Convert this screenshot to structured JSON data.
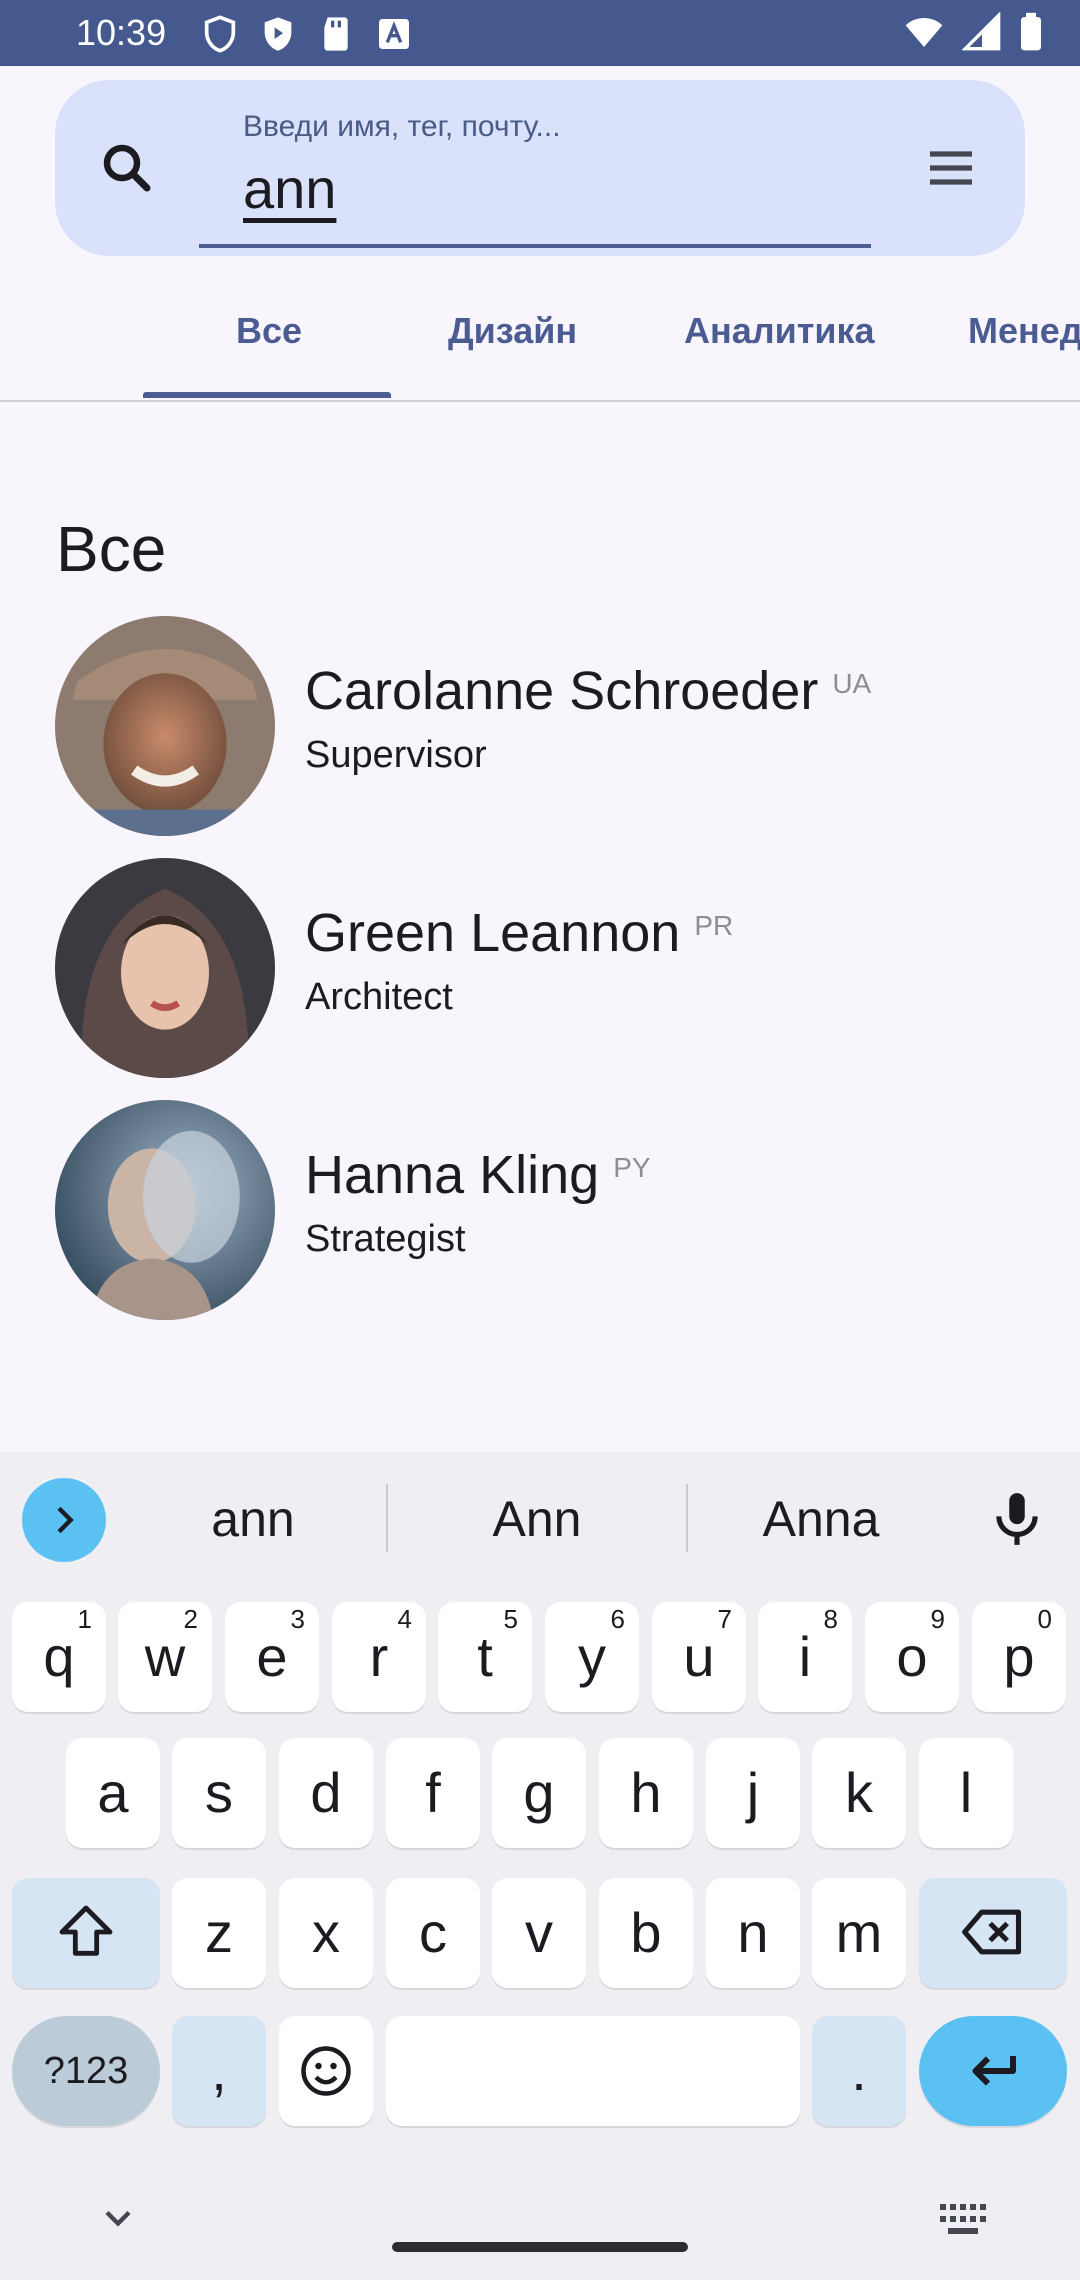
{
  "status_bar": {
    "time": "10:39"
  },
  "search": {
    "hint": "Введи имя, тег, почту...",
    "value": "ann"
  },
  "tabs": [
    {
      "label": "Все"
    },
    {
      "label": "Дизайн"
    },
    {
      "label": "Аналитика"
    },
    {
      "label": "Менедж"
    }
  ],
  "section": {
    "title": "Все"
  },
  "people": [
    {
      "name": "Carolanne Schroeder",
      "code": "UA",
      "role": "Supervisor"
    },
    {
      "name": "Green Leannon",
      "code": "PR",
      "role": "Architect"
    },
    {
      "name": "Hanna Kling",
      "code": "PY",
      "role": "Strategist"
    }
  ],
  "keyboard": {
    "suggestions": [
      "ann",
      "Ann",
      "Anna"
    ],
    "row1": [
      {
        "k": "q",
        "h": "1"
      },
      {
        "k": "w",
        "h": "2"
      },
      {
        "k": "e",
        "h": "3"
      },
      {
        "k": "r",
        "h": "4"
      },
      {
        "k": "t",
        "h": "5"
      },
      {
        "k": "y",
        "h": "6"
      },
      {
        "k": "u",
        "h": "7"
      },
      {
        "k": "i",
        "h": "8"
      },
      {
        "k": "o",
        "h": "9"
      },
      {
        "k": "p",
        "h": "0"
      }
    ],
    "row2": [
      "a",
      "s",
      "d",
      "f",
      "g",
      "h",
      "j",
      "k",
      "l"
    ],
    "row3": [
      "z",
      "x",
      "c",
      "v",
      "b",
      "n",
      "m"
    ],
    "symbols_label": "?123",
    "comma": ",",
    "period": "."
  },
  "colors": {
    "primary": "#4B5C92",
    "status_bar": "#45598F",
    "search_bg": "#DAE1FB",
    "accent_key": "#5BC1F3"
  }
}
